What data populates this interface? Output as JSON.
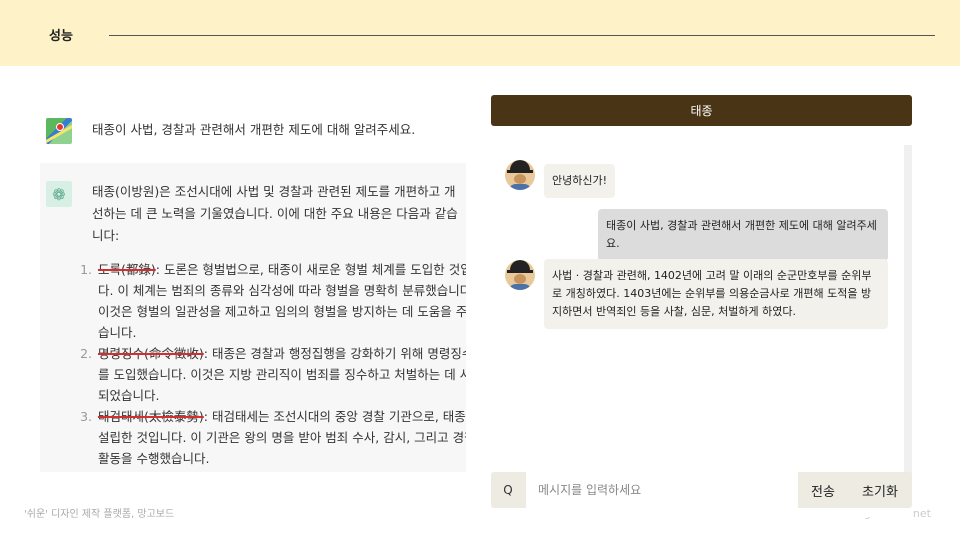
{
  "header": {
    "title": "성능"
  },
  "left": {
    "question": "태종이 사법, 경찰과 관련해서 개편한 제도에 대해 알려주세요.",
    "intro": "태종(이방원)은 조선시대에 사법 및 경찰과 관련된 제도를 개편하고 개선하는 데 큰 노력을 기울였습니다. 이에 대한 주요 내용은 다음과 같습니다:",
    "items": [
      {
        "term": "도록(都錄)",
        "desc": ": 도론은 형벌법으로, 태종이 새로운 형벌 체계를 도입한 것입니다. 이 체계는 범죄의 종류와 심각성에 따라 형벌을 명확히 분류했습니다. 이것은 형벌의 일관성을 제고하고 임의의 형벌을 방지하는 데 도움을 주었습니다."
      },
      {
        "term": "명령징수(命令徵收)",
        "desc": ": 태종은 경찰과 행정집행을 강화하기 위해 명령징수를 도입했습니다. 이것은 지방 관리직이 범죄를 징수하고 처벌하는 데 사용되었습니다."
      },
      {
        "term": "태검태세(太檢泰勢)",
        "desc": ": 태검태세는 조선시대의 중앙 경찰 기관으로, 태종이 설립한 것입니다. 이 기관은 왕의 명을 받아 범죄 수사, 감시, 그리고 경찰 활동을 수행했습니다."
      }
    ]
  },
  "chat": {
    "title": "태종",
    "messages": [
      {
        "role": "bot",
        "text": "안녕하신가!"
      },
      {
        "role": "user",
        "text": "태종이 사법, 경찰과 관련해서 개편한 제도에 대해 알려주세요."
      },
      {
        "role": "bot",
        "text": "사법 · 경찰과 관련해, 1402년에 고려 말 이래의 순군만호부를 순위부로 개칭하였다. 1403년에는 순위부를 의용순금사로 개편해 도적을 방지하면서 반역죄인 등을 사찰, 심문, 처벌하게 하였다."
      }
    ],
    "input": {
      "prefix": "Q",
      "placeholder": "메시지를 입력하세요",
      "value": ""
    },
    "send_label": "전송",
    "reset_label": "초기화"
  },
  "footer": {
    "note": "'쉬운' 디자인 제작 플랫폼, 망고보드",
    "watermark": "www.mangoboard.net"
  },
  "icons": {
    "user_avatar": "map-app-icon",
    "gpt_avatar": "chatgpt-logo-icon",
    "bot_avatar": "king-portrait-icon"
  },
  "colors": {
    "header_bg": "#fdf2c8",
    "chat_header": "#4a3416",
    "strike": "#d32f2f"
  }
}
